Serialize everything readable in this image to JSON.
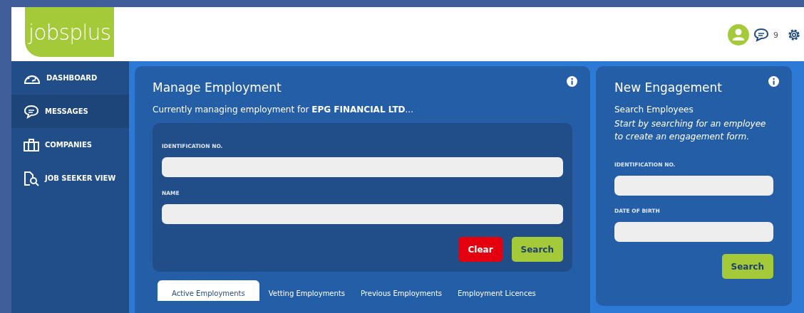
{
  "header": {
    "logo": "jobsplus",
    "messages_count": "9"
  },
  "sidebar": {
    "items": [
      {
        "label": "DASHBOARD",
        "kind": "dashboard",
        "selected": false
      },
      {
        "label": "MESSAGES",
        "kind": "messages",
        "selected": true
      },
      {
        "label": "COMPANIES",
        "kind": "companies",
        "selected": false
      },
      {
        "label": "JOB SEEKER VIEW",
        "kind": "jobseeker",
        "selected": false
      }
    ]
  },
  "manage": {
    "title": "Manage Employment",
    "subtitle": "Currently managing employment for **EPG FINANCIAL LTD**...",
    "fields": [
      {
        "label": "IDENTIFICATION NO."
      },
      {
        "label": "NAME"
      }
    ],
    "buttons": [
      {
        "label": "Clear",
        "kind": "danger"
      },
      {
        "label": "Search",
        "kind": "primary"
      }
    ],
    "tabs": [
      {
        "label": "Active Employments",
        "selected": true
      },
      {
        "label": "Vetting Employments",
        "selected": false
      },
      {
        "label": "Previous Employments",
        "selected": false
      },
      {
        "label": "Employment Licences",
        "selected": false
      }
    ]
  },
  "engagement": {
    "title": "New Engagement",
    "heading": "Search Employees",
    "hint": "Start by searching for an employee to create an engagement form.",
    "fields": [
      {
        "label": "IDENTIFICATION NO."
      },
      {
        "label": "DATE OF BIRTH"
      }
    ],
    "buttons": [
      {
        "label": "Search",
        "kind": "primary"
      }
    ]
  }
}
